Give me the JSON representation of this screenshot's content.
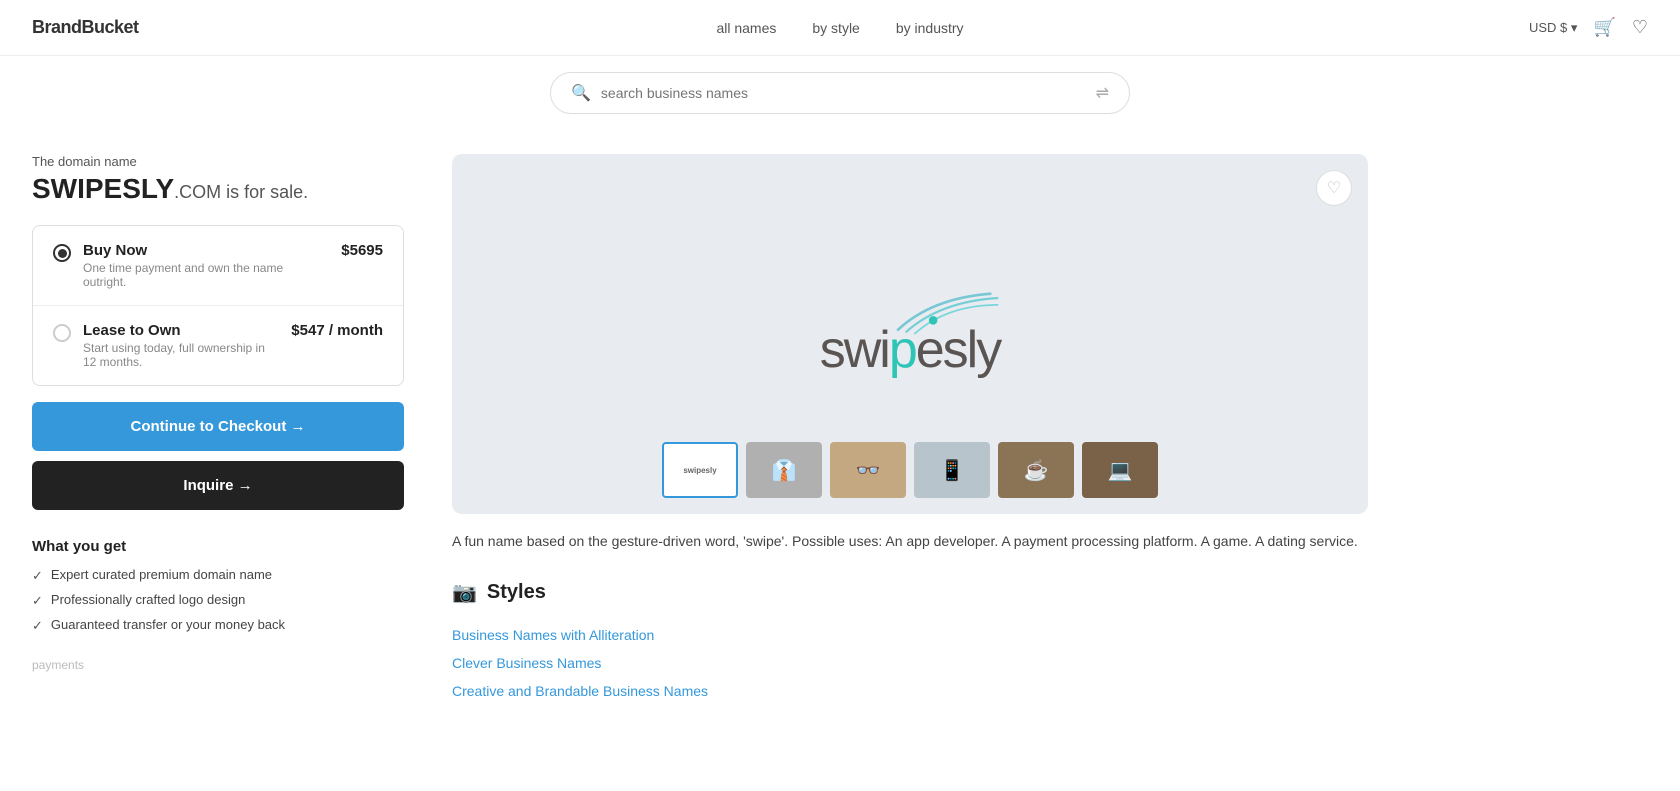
{
  "header": {
    "logo": "BrandBucket",
    "nav": [
      {
        "label": "all names",
        "href": "#"
      },
      {
        "label": "by style",
        "href": "#"
      },
      {
        "label": "by industry",
        "href": "#"
      }
    ],
    "currency": "USD $ ▾",
    "cart_icon": "🛒",
    "wishlist_icon": "♡"
  },
  "search": {
    "placeholder": "search business names"
  },
  "left": {
    "domain_label": "The domain name",
    "domain_name": "SWIPESLY",
    "domain_tld": ".COM is for sale.",
    "options": [
      {
        "id": "buy-now",
        "title": "Buy Now",
        "price": "$5695",
        "description": "One time payment and own the name outright.",
        "selected": true
      },
      {
        "id": "lease-to-own",
        "title": "Lease to Own",
        "price": "$547 / month",
        "description": "Start using today, full ownership in 12 months.",
        "selected": false
      }
    ],
    "checkout_btn": "Continue to Checkout →",
    "inquire_btn": "Inquire →",
    "what_you_get_title": "What you get",
    "benefits": [
      "Expert curated premium domain name",
      "Professionally crafted logo design",
      "Guaranteed transfer or your money back"
    ],
    "payments_label": "payments"
  },
  "right": {
    "wishlist_icon": "♡",
    "description": "A fun name based on the gesture-driven word, 'swipe'. Possible uses: An app developer. A payment processing platform. A game. A dating service.",
    "styles_title": "Styles",
    "styles": [
      "Business Names with Alliteration",
      "Clever Business Names",
      "Creative and Brandable Business Names"
    ],
    "thumbnails": [
      {
        "label": "logo",
        "type": "logo",
        "active": true
      },
      {
        "label": "mockup1",
        "type": "gray",
        "active": false
      },
      {
        "label": "mockup2",
        "type": "warm",
        "active": false
      },
      {
        "label": "mockup3",
        "type": "blue-gray",
        "active": false
      },
      {
        "label": "mockup4",
        "type": "wood",
        "active": false
      },
      {
        "label": "mockup5",
        "type": "dark-wood",
        "active": false
      }
    ]
  }
}
